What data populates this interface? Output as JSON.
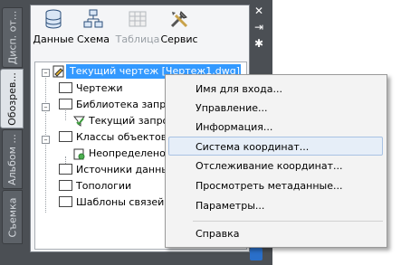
{
  "palette": {
    "side_tabs": [
      "Дисп. от...",
      "Обозрев...",
      "Альбом ...",
      "Съемка"
    ],
    "active_tab_index": 1,
    "toolbar": [
      {
        "label": "Данные",
        "icon": "database-icon",
        "enabled": true
      },
      {
        "label": "Схема",
        "icon": "schema-icon",
        "enabled": true
      },
      {
        "label": "Таблица",
        "icon": "table-icon",
        "enabled": false
      },
      {
        "label": "Сервис",
        "icon": "tools-icon",
        "enabled": true
      }
    ],
    "titlebar": {
      "close_glyph": "✕",
      "pin_glyph": "⇥",
      "menu_glyph": "✱"
    }
  },
  "tree": {
    "root": "Текущий чертеж [Чертеж1.dwg]",
    "items": [
      {
        "label": "Чертежи"
      },
      {
        "label": "Библиотека запросов"
      },
      {
        "label": "Текущий запрос"
      },
      {
        "label": "Классы объектов"
      },
      {
        "label": "Неопределено"
      },
      {
        "label": "Источники данных"
      },
      {
        "label": "Топологии"
      },
      {
        "label": "Шаблоны связей"
      }
    ]
  },
  "context_menu": {
    "items": [
      "Имя для входа...",
      "Управление...",
      "Информация...",
      "Система координат...",
      "Отслеживание координат...",
      "Просмотреть метаданные...",
      "Параметры...",
      "Справка"
    ],
    "hovered_index": 3
  }
}
